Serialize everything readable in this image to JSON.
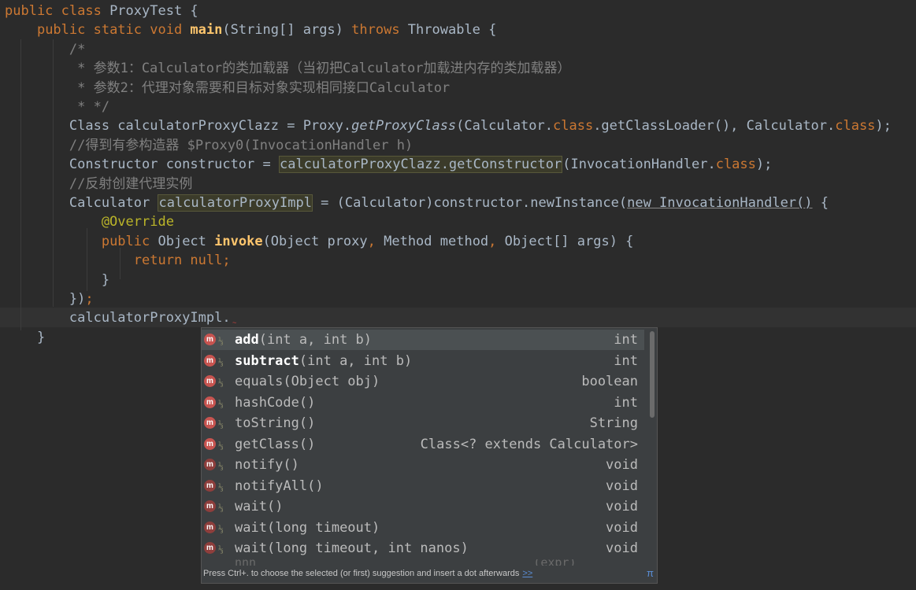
{
  "code_lines": [
    {
      "segments": [
        [
          "kw",
          "public class "
        ],
        [
          "",
          "ProxyTest {"
        ]
      ]
    },
    {
      "segments": [
        [
          "",
          "    "
        ],
        [
          "kw",
          "public static void "
        ],
        [
          "fn",
          "main"
        ],
        [
          "",
          "(String[] args) "
        ],
        [
          "kw",
          "throws "
        ],
        [
          "",
          "Throwable {"
        ]
      ]
    },
    {
      "segments": [
        [
          "cm",
          "        /*"
        ]
      ]
    },
    {
      "segments": [
        [
          "cm",
          "         * 参数1：Calculator的类加载器（当初把Calculator加载进内存的类加载器）"
        ]
      ]
    },
    {
      "segments": [
        [
          "cm",
          "         * 参数2：代理对象需要和目标对象实现相同接口Calculator"
        ]
      ]
    },
    {
      "segments": [
        [
          "cm",
          "         * */"
        ]
      ]
    },
    {
      "segments": [
        [
          "",
          "        Class calculatorProxyClazz = Proxy."
        ],
        [
          "it",
          "getProxyClass"
        ],
        [
          "",
          "(Calculator."
        ],
        [
          "kw",
          "class"
        ],
        [
          "",
          ".getClassLoader(), Calculator."
        ],
        [
          "kw",
          "class"
        ],
        [
          "",
          ");"
        ]
      ]
    },
    {
      "segments": [
        [
          "cm",
          "        //得到有参构造器 $Proxy0(InvocationHandler h)"
        ]
      ]
    },
    {
      "segments": [
        [
          "",
          "        Constructor constructor = "
        ],
        [
          "hl",
          "calculatorProxyClazz.getConstructor"
        ],
        [
          "",
          "(InvocationHandler."
        ],
        [
          "kw",
          "class"
        ],
        [
          "",
          ");"
        ]
      ]
    },
    {
      "segments": [
        [
          "cm",
          "        //反射创建代理实例"
        ]
      ]
    },
    {
      "segments": [
        [
          "",
          "        Calculator "
        ],
        [
          "hl",
          "calculatorProxyImpl"
        ],
        [
          "",
          " = (Calculator)constructor.newInstance("
        ],
        [
          "und",
          "new InvocationHandler()"
        ],
        [
          "",
          " {"
        ]
      ]
    },
    {
      "segments": [
        [
          "an",
          "            @Override"
        ]
      ]
    },
    {
      "segments": [
        [
          "",
          "            "
        ],
        [
          "kw",
          "public "
        ],
        [
          "",
          "Object "
        ],
        [
          "fn",
          "invoke"
        ],
        [
          "",
          "(Object proxy"
        ],
        [
          "kw",
          ", "
        ],
        [
          "",
          "Method method"
        ],
        [
          "kw",
          ", "
        ],
        [
          "",
          "Object[] args) {"
        ]
      ]
    },
    {
      "segments": [
        [
          "",
          "                "
        ],
        [
          "kw",
          "return null;"
        ]
      ]
    },
    {
      "segments": [
        [
          "",
          "            }"
        ]
      ]
    },
    {
      "segments": [
        [
          "",
          "        })"
        ],
        [
          "kw",
          ";"
        ]
      ]
    },
    {
      "segments": [
        [
          "",
          "        calculatorProxyImpl."
        ]
      ]
    },
    {
      "segments": [
        [
          "",
          "    }"
        ]
      ]
    }
  ],
  "completion": {
    "items": [
      {
        "name": "add",
        "params": "(int a, int b)",
        "type": "int",
        "bold": true,
        "selected": true,
        "icon": "method-icon"
      },
      {
        "name": "subtract",
        "params": "(int a, int b)",
        "type": "int",
        "bold": true,
        "selected": false,
        "icon": "method-icon"
      },
      {
        "name": "equals",
        "params": "(Object obj)",
        "type": "boolean",
        "bold": false,
        "selected": false,
        "icon": "method-icon"
      },
      {
        "name": "hashCode",
        "params": "()",
        "type": "int",
        "bold": false,
        "selected": false,
        "icon": "method-icon"
      },
      {
        "name": "toString",
        "params": "()",
        "type": "String",
        "bold": false,
        "selected": false,
        "icon": "method-icon"
      },
      {
        "name": "getClass",
        "params": "()",
        "type": "Class<? extends Calculator>",
        "bold": false,
        "selected": false,
        "icon": "method-icon"
      },
      {
        "name": "notify",
        "params": "()",
        "type": "void",
        "bold": false,
        "selected": false,
        "icon": "final-method-icon"
      },
      {
        "name": "notifyAll",
        "params": "()",
        "type": "void",
        "bold": false,
        "selected": false,
        "icon": "final-method-icon"
      },
      {
        "name": "wait",
        "params": "()",
        "type": "void",
        "bold": false,
        "selected": false,
        "icon": "final-method-icon"
      },
      {
        "name": "wait",
        "params": "(long timeout)",
        "type": "void",
        "bold": false,
        "selected": false,
        "icon": "final-method-icon"
      },
      {
        "name": "wait",
        "params": "(long timeout, int nanos)",
        "type": "void",
        "bold": false,
        "selected": false,
        "icon": "final-method-icon"
      }
    ],
    "partial_item": "nnn                                       (expr)",
    "footer_text": "Press Ctrl+. to choose the selected (or first) suggestion and insert a dot afterwards",
    "footer_link": ">>",
    "footer_icon": "π"
  },
  "colors": {
    "background": "#2b2b2b",
    "keyword": "#cc7832",
    "method_decl": "#ffc66d",
    "comment": "#808080",
    "annotation": "#bbb529",
    "popup_bg": "#3c3f41"
  }
}
